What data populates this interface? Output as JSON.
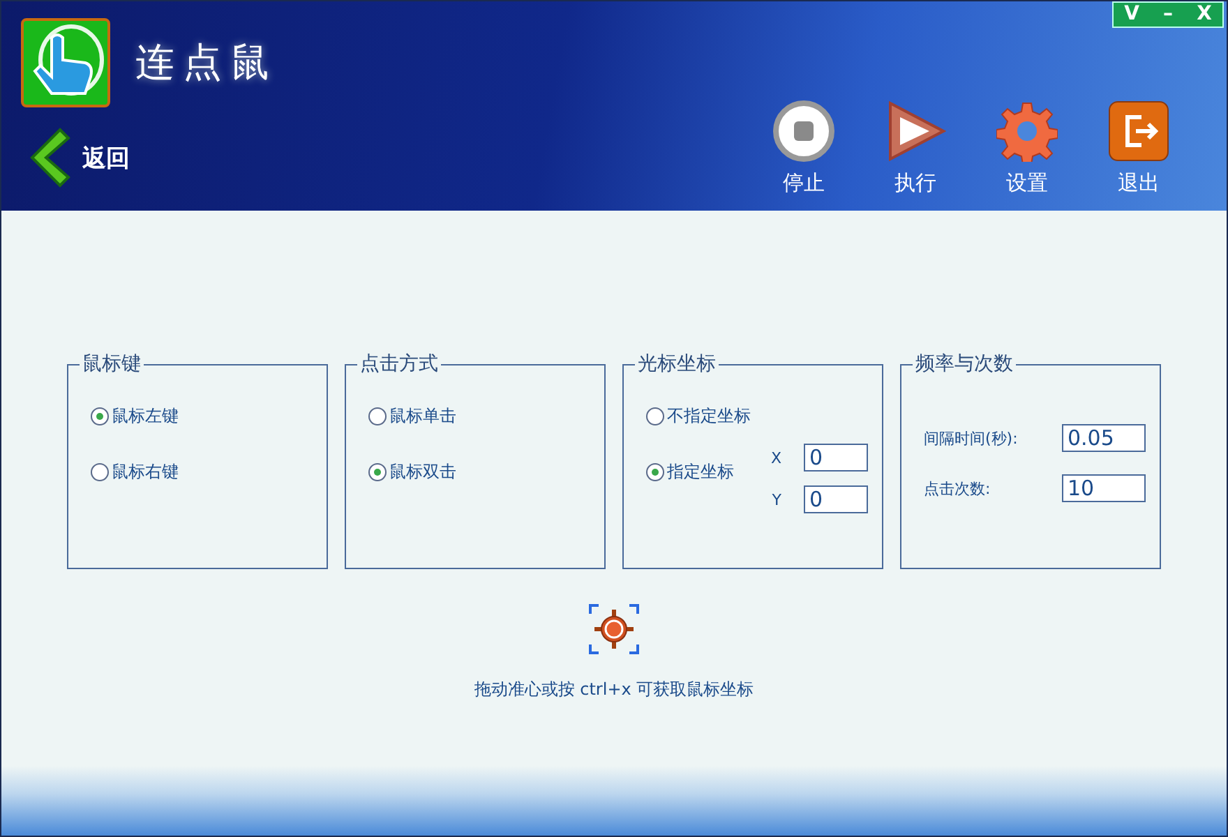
{
  "window": {
    "title": "连点鼠",
    "controls": [
      "V",
      "–",
      "X"
    ]
  },
  "back": {
    "label": "返回"
  },
  "toolbar": [
    {
      "kind": "stop",
      "label": "停止"
    },
    {
      "kind": "run",
      "label": "执行"
    },
    {
      "kind": "settings",
      "label": "设置"
    },
    {
      "kind": "exit",
      "label": "退出"
    }
  ],
  "groups": [
    {
      "kind": "radios",
      "title": "鼠标键",
      "options": [
        {
          "label": "鼠标左键",
          "selected": true
        },
        {
          "label": "鼠标右键",
          "selected": false
        }
      ]
    },
    {
      "kind": "radios",
      "title": "点击方式",
      "options": [
        {
          "label": "鼠标单击",
          "selected": false
        },
        {
          "label": "鼠标双击",
          "selected": true
        }
      ]
    },
    {
      "kind": "coords",
      "title": "光标坐标",
      "options": [
        {
          "label": "不指定坐标",
          "selected": false
        },
        {
          "label": "指定坐标",
          "selected": true
        }
      ],
      "fields": [
        {
          "label": "X",
          "value": "0"
        },
        {
          "label": "Y",
          "value": "0"
        }
      ]
    },
    {
      "kind": "fields",
      "title": "频率与次数",
      "fields": [
        {
          "label": "间隔时间(秒):",
          "value": "0.05"
        },
        {
          "label": "点击次数:",
          "value": "10"
        }
      ]
    }
  ],
  "hint": "拖动准心或按 ctrl+x 可获取鼠标坐标"
}
